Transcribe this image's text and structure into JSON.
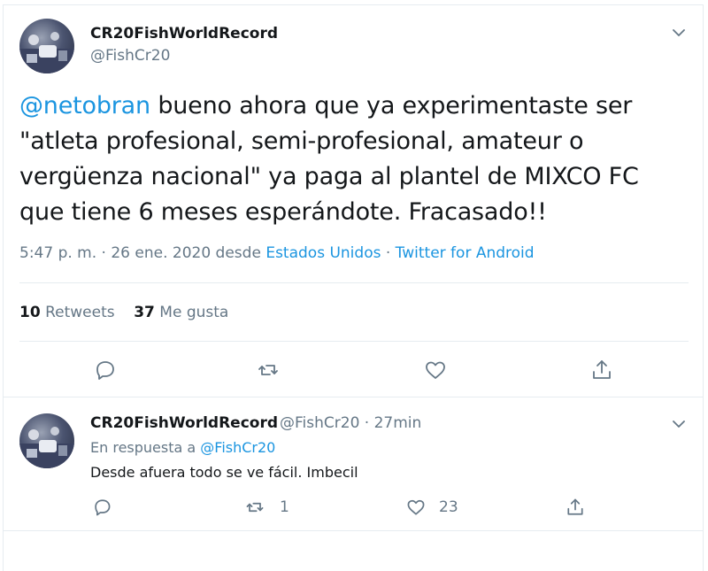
{
  "main_tweet": {
    "author_name": "CR20FishWorldRecord",
    "author_handle": "@FishCr20",
    "text_mention": "@netobran",
    "text_body": " bueno ahora que ya experimentaste ser \"atleta profesional, semi-profesional, amateur o vergüenza nacional\" ya paga al plantel de MIXCO FC que tiene 6 meses esperándote. Fracasado!!",
    "time_date": "5:47 p. m. · 26 ene. 2020 desde ",
    "location": "Estados Unidos",
    "separator": " · ",
    "source": "Twitter for Android",
    "retweets_count": "10",
    "retweets_label": " Retweets",
    "likes_count": "37",
    "likes_label": " Me gusta",
    "icons": [
      "reply-icon",
      "retweet-icon",
      "like-icon",
      "share-icon",
      "chevron-down-icon"
    ]
  },
  "reply_tweet": {
    "author_name": "CR20FishWorldRecord",
    "author_handle_time": "@FishCr20 · 27min",
    "reply_prefix": "En respuesta a ",
    "reply_to": "@FishCr20",
    "text": "Desde afuera todo se ve fácil. Imbecil",
    "retweet_count": "1",
    "like_count": "23"
  },
  "colors": {
    "link": "#1b95e0",
    "secondary_text": "#657786",
    "primary_text": "#14171a",
    "divider": "#e6ecf0"
  }
}
